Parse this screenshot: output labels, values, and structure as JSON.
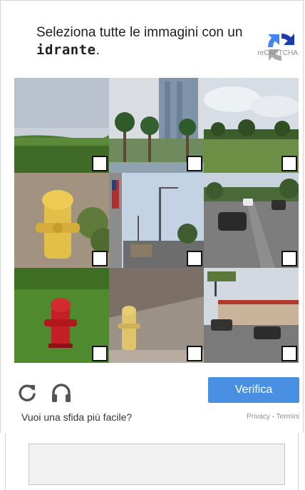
{
  "header": {
    "instruction_prefix": "Seleziona tutte le immagini con un",
    "instruction_target": "idrante",
    "instruction_suffix": ".",
    "brand": "reCAPTCHA"
  },
  "grid": {
    "tiles": [
      {
        "scene": "grass-field-sky",
        "checked": false
      },
      {
        "scene": "palm-trees-building",
        "checked": false
      },
      {
        "scene": "field-trees-cloudy",
        "checked": false
      },
      {
        "scene": "yellow-fire-hydrant",
        "checked": false
      },
      {
        "scene": "street-flag-poles",
        "checked": false
      },
      {
        "scene": "road-with-cars",
        "checked": false
      },
      {
        "scene": "red-fire-hydrant",
        "checked": false
      },
      {
        "scene": "yellow-hydrant-sidewalk",
        "checked": false
      },
      {
        "scene": "roadside-shops",
        "checked": false
      }
    ]
  },
  "footer": {
    "reload_icon": "reload-icon",
    "audio_icon": "headphones-icon",
    "verify_label": "Verifica",
    "easier_label": "Vuoi una sfida più facile?",
    "privacy_label": "Privacy",
    "separator": " - ",
    "terms_label": "Termini"
  },
  "colors": {
    "verify_button": "#4a90e2",
    "icon_gray": "#555555",
    "text_gray": "#8e8e8e"
  }
}
